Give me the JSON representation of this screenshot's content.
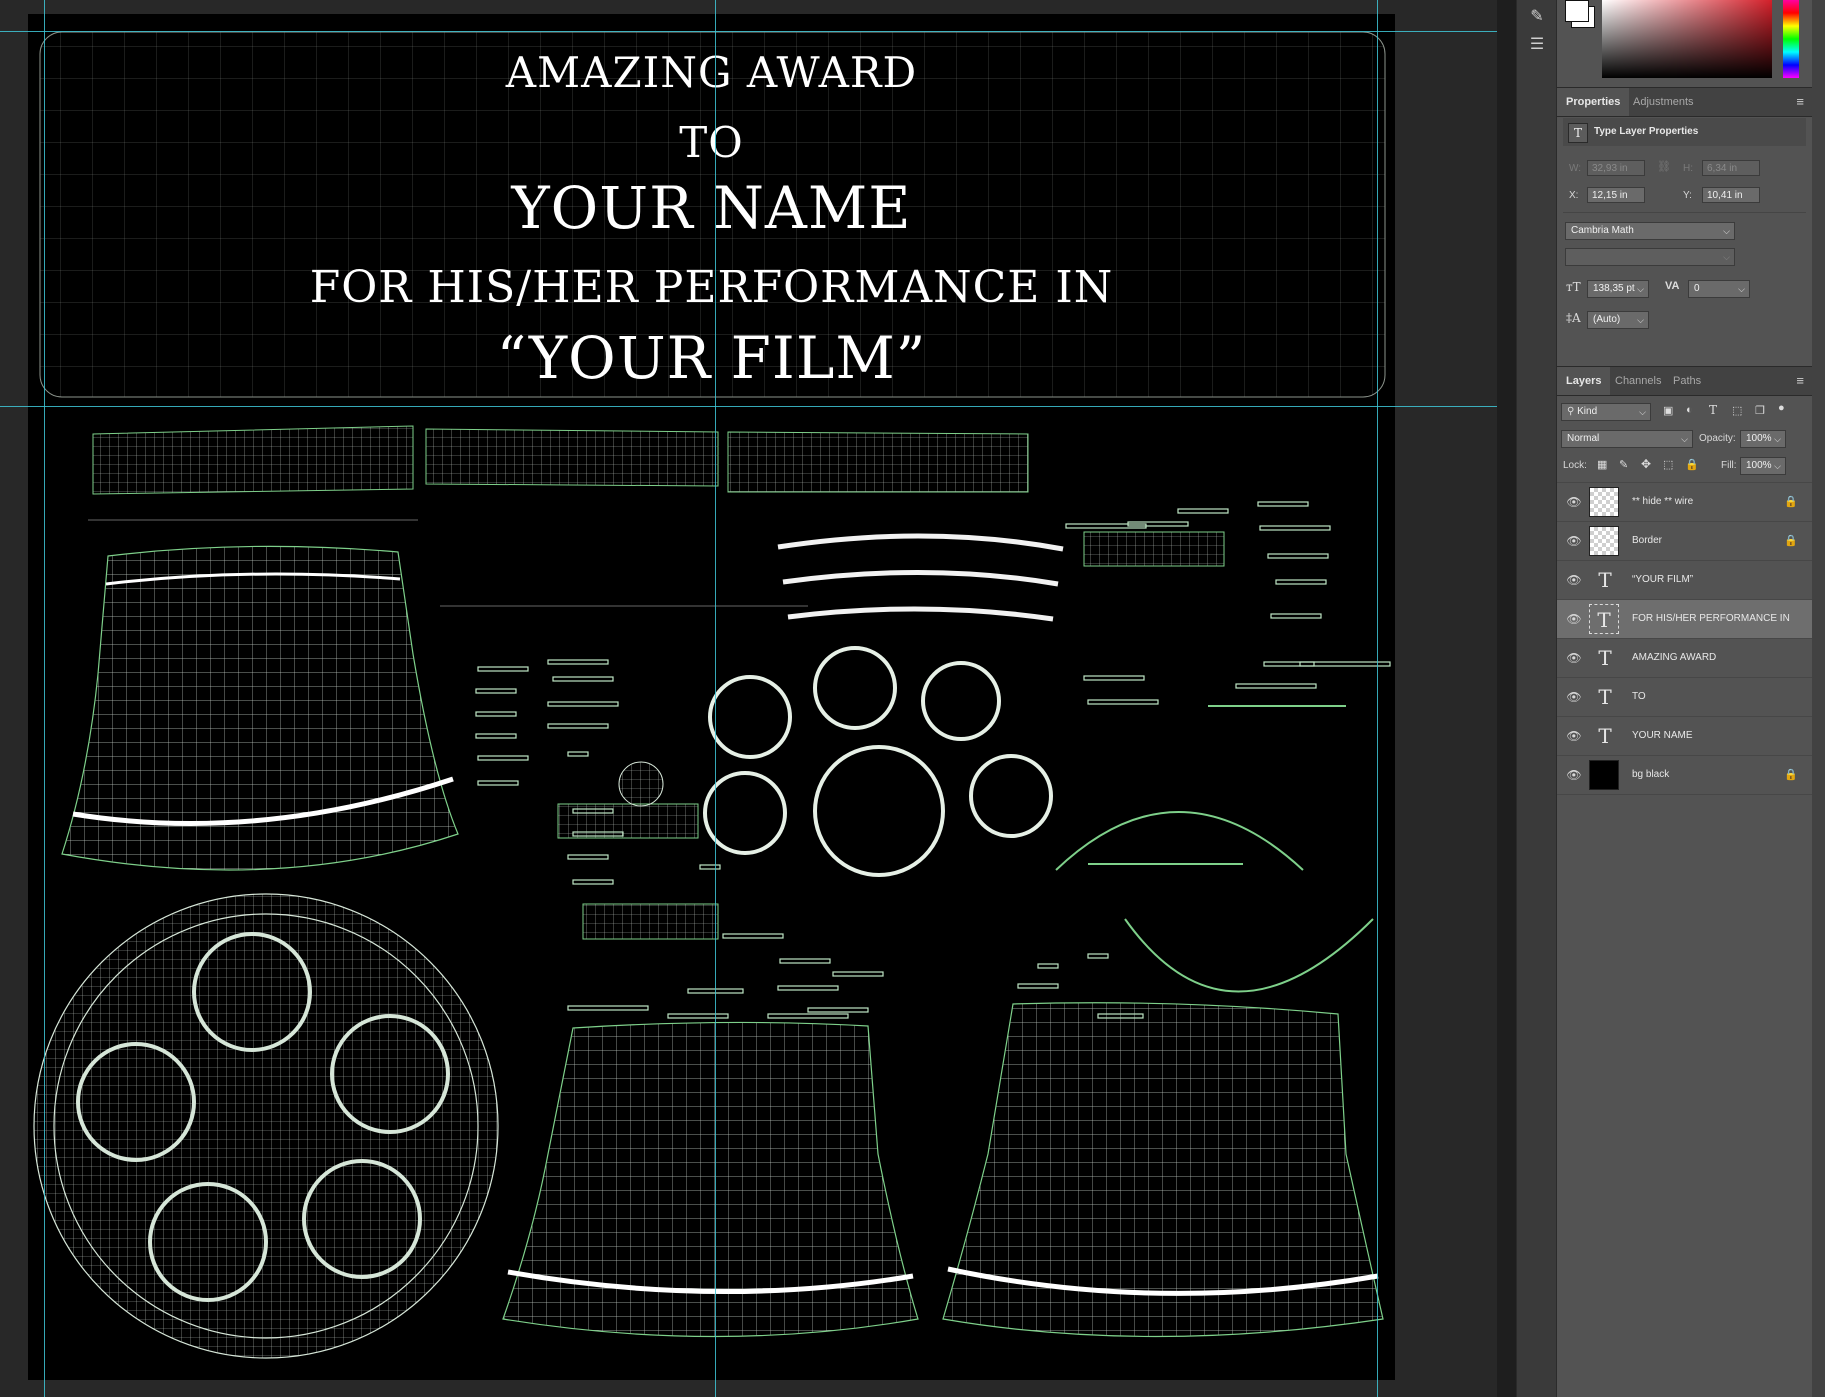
{
  "canvas": {
    "lines": [
      {
        "text": "AMAZING AWARD",
        "name": "award-line-amazing-award"
      },
      {
        "text": "TO",
        "name": "award-line-to"
      },
      {
        "text": "YOUR NAME",
        "name": "award-line-your-name"
      },
      {
        "text": "FOR HIS/HER PERFORMANCE IN",
        "name": "award-line-performance"
      },
      {
        "text": "“YOUR FILM”",
        "name": "award-line-your-film"
      }
    ],
    "guide_color": "#3ec6d6",
    "wire_color": "#e8f2ea"
  },
  "properties_panel": {
    "tabs": {
      "properties": "Properties",
      "adjustments": "Adjustments"
    },
    "title": "Type Layer Properties",
    "title_icon": "type-icon",
    "w_label": "W:",
    "w_value": "32,93 in",
    "h_label": "H:",
    "h_value": "6,34 in",
    "x_label": "X:",
    "x_value": "12,15 in",
    "y_label": "Y:",
    "y_value": "10,41 in",
    "font_family": "Cambria Math",
    "font_size": "138,35 pt",
    "tracking": "0",
    "leading": "(Auto)"
  },
  "layers_panel": {
    "tabs": {
      "layers": "Layers",
      "channels": "Channels",
      "paths": "Paths"
    },
    "filter_kind": "Kind",
    "blend_mode": "Normal",
    "opacity_label": "Opacity:",
    "opacity_value": "100%",
    "lock_label": "Lock:",
    "fill_label": "Fill:",
    "fill_value": "100%",
    "layers": [
      {
        "name": "** hide ** wire",
        "kind": "smart-object",
        "locked": true,
        "selected": false
      },
      {
        "name": "Border",
        "kind": "raster",
        "locked": true,
        "selected": false
      },
      {
        "name": "“YOUR FILM”",
        "kind": "type",
        "locked": false,
        "selected": false
      },
      {
        "name": "FOR HIS/HER PERFORMANCE IN",
        "kind": "type",
        "locked": false,
        "selected": true
      },
      {
        "name": "AMAZING AWARD",
        "kind": "type",
        "locked": false,
        "selected": false
      },
      {
        "name": "TO",
        "kind": "type",
        "locked": false,
        "selected": false
      },
      {
        "name": "YOUR NAME",
        "kind": "type",
        "locked": false,
        "selected": false
      },
      {
        "name": "bg black",
        "kind": "fill",
        "locked": true,
        "selected": false
      }
    ]
  }
}
